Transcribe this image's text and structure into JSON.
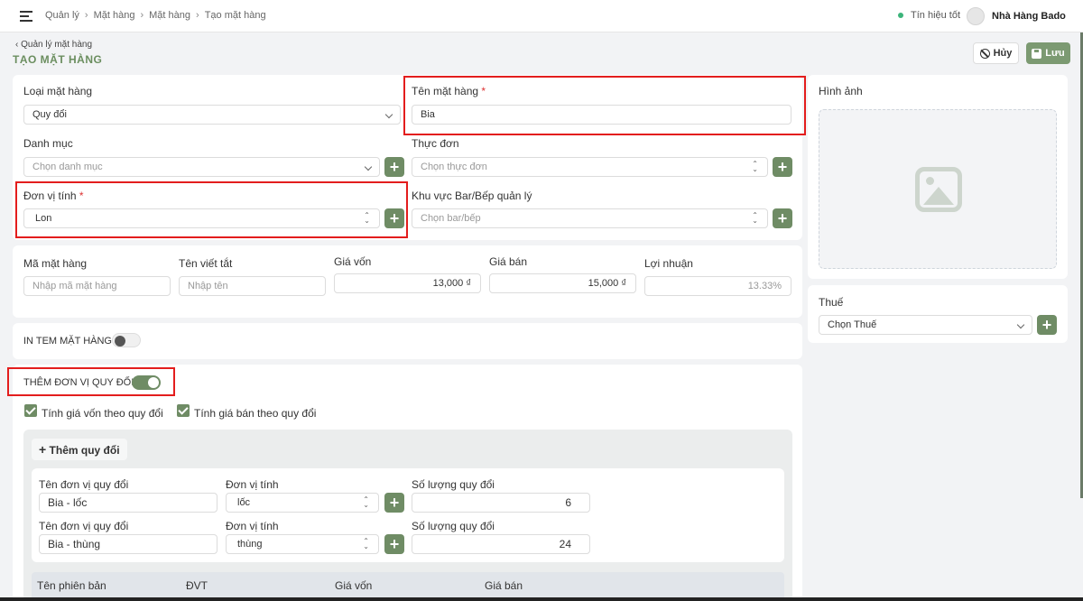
{
  "header": {
    "breadcrumb": [
      "Quản lý",
      "Mặt hàng",
      "Mặt hàng",
      "Tạo mặt hàng"
    ],
    "signal_text": "Tín hiệu tốt",
    "store_name": "Nhà Hàng Bado"
  },
  "page": {
    "back_label": "Quản lý mặt hàng",
    "title": "TẠO MẶT HÀNG",
    "cancel_label": "Hủy",
    "save_label": "Lưu"
  },
  "form": {
    "item_type_label": "Loại mặt hàng",
    "item_type_value": "Quy đổi",
    "item_name_label": "Tên mặt hàng",
    "item_name_value": "Bia",
    "category_label": "Danh mục",
    "category_placeholder": "Chọn danh mục",
    "menu_label": "Thực đơn",
    "menu_placeholder": "Chọn thực đơn",
    "unit_label": "Đơn vị tính",
    "unit_value": "Lon",
    "bar_label": "Khu vực Bar/Bếp quản lý",
    "bar_placeholder": "Chọn bar/bếp",
    "code_label": "Mã mặt hàng",
    "code_placeholder": "Nhập mã mặt hàng",
    "short_name_label": "Tên viết tắt",
    "short_name_placeholder": "Nhập tên",
    "cost_label": "Giá vốn",
    "cost_value": "13,000 ₫",
    "price_label": "Giá bán",
    "price_value": "15,000 ₫",
    "profit_label": "Lợi nhuận",
    "profit_value": "13.33%",
    "print_label_text": "IN TEM MẶT HÀNG",
    "print_label_on": false,
    "add_conversion_text": "THÊM ĐƠN VỊ QUY ĐỔI",
    "add_conversion_on": true,
    "calc_cost_label": "Tính giá vốn theo quy đổi",
    "calc_price_label": "Tính giá bán theo quy đổi",
    "add_conversion_button": "Thêm quy đổi"
  },
  "conversions": [
    {
      "name_label": "Tên đơn vị quy đổi",
      "name_value": "Bia - lốc",
      "unit_label": "Đơn vị tính",
      "unit_value": "lốc",
      "qty_label": "Số lượng quy đổi",
      "qty_value": "6"
    },
    {
      "name_label": "Tên đơn vị quy đổi",
      "name_value": "Bia - thùng",
      "unit_label": "Đơn vị tính",
      "unit_value": "thùng",
      "qty_label": "Số lượng quy đổi",
      "qty_value": "24"
    }
  ],
  "variant_table": {
    "headers": [
      "Tên phiên bản",
      "ĐVT",
      "Giá vốn",
      "Giá bán"
    ]
  },
  "sidebar": {
    "image_label": "Hình ảnh",
    "tax_label": "Thuế",
    "tax_placeholder": "Chọn Thuế"
  }
}
